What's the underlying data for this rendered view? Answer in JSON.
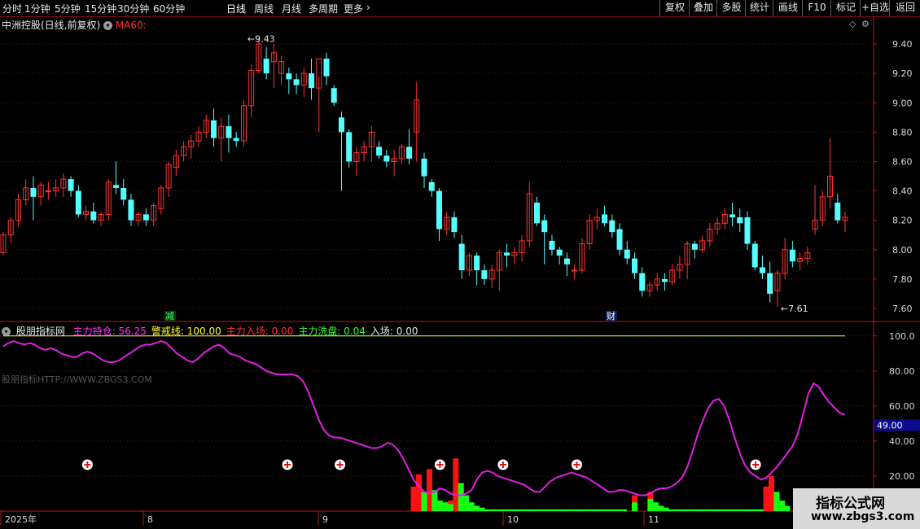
{
  "toolbar": {
    "periods": [
      "分时",
      "1分钟",
      "5分钟",
      "15分钟",
      "30分钟",
      "60分钟",
      "日线",
      "周线",
      "月线",
      "多周期",
      "更多"
    ],
    "active_period": "日线",
    "right_buttons": [
      "复权",
      "叠加",
      "多股",
      "统计",
      "画线",
      "F10",
      "标记",
      "+自选",
      "返回"
    ]
  },
  "header": {
    "stock_name": "中洲控股(日线,前复权)",
    "ma_label": "MA60:"
  },
  "chart_labels": {
    "high_label": "9.43",
    "low_label": "7.61",
    "badge_jian": "减",
    "badge_cai": "财"
  },
  "indicator": {
    "name": "股朋指标网",
    "items": [
      {
        "label": "主力持仓:",
        "value": "56.25",
        "color": "#ff33ff"
      },
      {
        "label": "警戒线:",
        "value": "100.00",
        "color": "#ffff33"
      },
      {
        "label": "主力入场:",
        "value": "0.00",
        "color": "#ff3333"
      },
      {
        "label": "主力洗盘:",
        "value": "0.04",
        "color": "#33ff33"
      },
      {
        "label": "入场:",
        "value": "0.00",
        "color": "#e8e8e8"
      }
    ],
    "watermark": "股朋指标HTTP://WWW.ZBGS3.COM",
    "current_value_tag": "49.00"
  },
  "price_axis": [
    "9.40",
    "9.20",
    "9.00",
    "8.80",
    "8.60",
    "8.40",
    "8.20",
    "8.00",
    "7.80",
    "7.60"
  ],
  "indicator_axis": [
    "100.0",
    "80.00",
    "60.00",
    "40.00",
    "20.00"
  ],
  "x_axis_labels": [
    "2025年",
    "8",
    "9",
    "10",
    "11"
  ],
  "logo": {
    "line1": "指标公式网",
    "line2": "www.zbgs3.com"
  },
  "colors": {
    "up": "#ff3333",
    "down": "#54ffff",
    "grid": "#5a1414",
    "axis": "#b01c1c",
    "line": "#e020e0"
  },
  "chart_data": [
    {
      "type": "candlestick",
      "title": "中洲控股(日线,前复权)",
      "ylim": [
        7.55,
        9.5
      ],
      "candles_ohlc": [
        [
          7.98,
          8.12,
          7.96,
          8.1
        ],
        [
          8.1,
          8.22,
          8.04,
          8.2
        ],
        [
          8.2,
          8.38,
          8.16,
          8.34
        ],
        [
          8.34,
          8.48,
          8.3,
          8.42
        ],
        [
          8.42,
          8.5,
          8.2,
          8.36
        ],
        [
          8.36,
          8.46,
          8.3,
          8.44
        ],
        [
          8.4,
          8.46,
          8.34,
          8.4
        ],
        [
          8.4,
          8.48,
          8.36,
          8.42
        ],
        [
          8.42,
          8.52,
          8.36,
          8.48
        ],
        [
          8.48,
          8.5,
          8.36,
          8.4
        ],
        [
          8.4,
          8.44,
          8.22,
          8.24
        ],
        [
          8.24,
          8.3,
          8.2,
          8.26
        ],
        [
          8.26,
          8.32,
          8.18,
          8.2
        ],
        [
          8.2,
          8.26,
          8.16,
          8.24
        ],
        [
          8.24,
          8.48,
          8.2,
          8.46
        ],
        [
          8.44,
          8.6,
          8.38,
          8.42
        ],
        [
          8.42,
          8.48,
          8.3,
          8.34
        ],
        [
          8.34,
          8.38,
          8.16,
          8.2
        ],
        [
          8.2,
          8.26,
          8.16,
          8.24
        ],
        [
          8.24,
          8.28,
          8.16,
          8.2
        ],
        [
          8.2,
          8.32,
          8.16,
          8.3
        ],
        [
          8.28,
          8.44,
          8.24,
          8.42
        ],
        [
          8.42,
          8.6,
          8.36,
          8.58
        ],
        [
          8.56,
          8.68,
          8.5,
          8.64
        ],
        [
          8.64,
          8.74,
          8.6,
          8.7
        ],
        [
          8.7,
          8.78,
          8.62,
          8.74
        ],
        [
          8.74,
          8.84,
          8.7,
          8.8
        ],
        [
          8.8,
          8.92,
          8.76,
          8.88
        ],
        [
          8.88,
          8.96,
          8.7,
          8.76
        ],
        [
          8.76,
          8.9,
          8.6,
          8.84
        ],
        [
          8.84,
          8.92,
          8.66,
          8.76
        ],
        [
          8.76,
          8.8,
          8.7,
          8.74
        ],
        [
          8.74,
          9.02,
          8.7,
          8.98
        ],
        [
          8.98,
          9.26,
          8.9,
          9.22
        ],
        [
          9.22,
          9.43,
          9.2,
          9.4
        ],
        [
          9.3,
          9.38,
          9.16,
          9.2
        ],
        [
          9.28,
          9.4,
          9.1,
          9.34
        ],
        [
          9.2,
          9.32,
          9.12,
          9.28
        ],
        [
          9.2,
          9.24,
          9.06,
          9.16
        ],
        [
          9.16,
          9.2,
          9.06,
          9.12
        ],
        [
          9.12,
          9.24,
          9.04,
          9.2
        ],
        [
          9.2,
          9.3,
          9.02,
          9.1
        ],
        [
          9.1,
          9.18,
          8.8,
          9.3
        ],
        [
          9.3,
          9.34,
          9.12,
          9.18
        ],
        [
          9.1,
          9.12,
          8.98,
          9.0
        ],
        [
          8.9,
          8.94,
          8.4,
          8.8
        ],
        [
          8.8,
          8.82,
          8.56,
          8.6
        ],
        [
          8.6,
          8.7,
          8.5,
          8.66
        ],
        [
          8.66,
          8.74,
          8.6,
          8.7
        ],
        [
          8.7,
          8.84,
          8.6,
          8.8
        ],
        [
          8.7,
          8.74,
          8.62,
          8.64
        ],
        [
          8.64,
          8.68,
          8.56,
          8.6
        ],
        [
          8.6,
          8.68,
          8.5,
          8.62
        ],
        [
          8.62,
          8.72,
          8.58,
          8.7
        ],
        [
          8.7,
          8.82,
          8.58,
          8.62
        ],
        [
          8.8,
          9.14,
          8.6,
          9.02
        ],
        [
          8.62,
          8.66,
          8.42,
          8.5
        ],
        [
          8.46,
          8.48,
          8.36,
          8.4
        ],
        [
          8.4,
          8.42,
          8.06,
          8.14
        ],
        [
          8.14,
          8.26,
          8.1,
          8.22
        ],
        [
          8.22,
          8.26,
          8.08,
          8.12
        ],
        [
          8.04,
          8.1,
          7.8,
          7.86
        ],
        [
          7.86,
          7.98,
          7.82,
          7.96
        ],
        [
          7.96,
          7.98,
          7.76,
          7.86
        ],
        [
          7.86,
          7.9,
          7.76,
          7.8
        ],
        [
          7.8,
          7.9,
          7.74,
          7.86
        ],
        [
          7.86,
          8.0,
          7.72,
          7.98
        ],
        [
          7.98,
          8.04,
          7.88,
          7.96
        ],
        [
          7.96,
          8.02,
          7.9,
          7.98
        ],
        [
          7.98,
          8.1,
          7.92,
          8.06
        ],
        [
          8.06,
          8.46,
          8.02,
          8.38
        ],
        [
          8.32,
          8.36,
          8.16,
          8.18
        ],
        [
          8.2,
          8.24,
          7.9,
          8.12
        ],
        [
          8.06,
          8.1,
          7.96,
          8.0
        ],
        [
          8.0,
          8.02,
          7.9,
          7.96
        ],
        [
          7.94,
          7.98,
          7.82,
          7.9
        ],
        [
          7.86,
          7.9,
          7.8,
          7.86
        ],
        [
          7.86,
          8.08,
          7.84,
          8.04
        ],
        [
          8.04,
          8.24,
          8.0,
          8.2
        ],
        [
          8.2,
          8.28,
          8.14,
          8.22
        ],
        [
          8.24,
          8.3,
          8.16,
          8.18
        ],
        [
          8.2,
          8.24,
          8.08,
          8.12
        ],
        [
          8.14,
          8.18,
          7.96,
          8.0
        ],
        [
          8.0,
          8.06,
          7.9,
          7.94
        ],
        [
          7.94,
          7.98,
          7.8,
          7.84
        ],
        [
          7.84,
          7.88,
          7.68,
          7.72
        ],
        [
          7.72,
          7.78,
          7.68,
          7.76
        ],
        [
          7.76,
          7.84,
          7.72,
          7.8
        ],
        [
          7.8,
          7.84,
          7.72,
          7.78
        ],
        [
          7.78,
          7.9,
          7.76,
          7.86
        ],
        [
          7.86,
          7.96,
          7.8,
          7.9
        ],
        [
          7.9,
          8.06,
          7.8,
          8.04
        ],
        [
          8.04,
          8.06,
          7.94,
          8.0
        ],
        [
          8.0,
          8.1,
          7.98,
          8.06
        ],
        [
          8.06,
          8.18,
          8.02,
          8.14
        ],
        [
          8.14,
          8.22,
          8.1,
          8.18
        ],
        [
          8.18,
          8.28,
          8.14,
          8.24
        ],
        [
          8.24,
          8.32,
          8.16,
          8.22
        ],
        [
          8.22,
          8.28,
          8.12,
          8.18
        ],
        [
          8.22,
          8.26,
          8.0,
          8.04
        ],
        [
          8.04,
          8.06,
          7.86,
          7.88
        ],
        [
          7.88,
          7.96,
          7.8,
          7.84
        ],
        [
          7.84,
          7.92,
          7.64,
          7.7
        ],
        [
          7.72,
          7.86,
          7.61,
          7.84
        ],
        [
          7.84,
          8.08,
          7.8,
          8.0
        ],
        [
          8.0,
          8.06,
          7.88,
          7.92
        ],
        [
          7.92,
          7.98,
          7.86,
          7.94
        ],
        [
          7.94,
          8.02,
          7.9,
          7.98
        ],
        [
          8.14,
          8.44,
          8.1,
          8.2
        ],
        [
          8.2,
          8.4,
          8.16,
          8.36
        ],
        [
          8.36,
          8.76,
          8.28,
          8.5
        ],
        [
          8.32,
          8.38,
          8.18,
          8.2
        ],
        [
          8.2,
          8.26,
          8.12,
          8.22
        ]
      ]
    },
    {
      "type": "line",
      "title": "股朋指标网",
      "ylim": [
        0,
        105
      ],
      "series": [
        {
          "name": "主力持仓",
          "values": [
            94,
            96,
            97,
            96,
            95,
            96,
            95,
            93,
            92,
            93,
            92,
            90,
            89,
            88,
            88,
            90,
            91,
            90,
            88,
            86,
            85,
            85,
            86,
            88,
            90,
            92,
            94,
            95,
            95,
            96,
            97,
            96,
            93,
            90,
            88,
            86,
            85,
            87,
            90,
            92,
            94,
            95,
            93,
            90,
            89,
            88,
            86,
            85,
            84,
            82,
            80,
            79,
            78,
            78,
            78,
            78,
            77,
            74,
            68,
            60,
            52,
            46,
            43,
            42,
            42,
            41,
            40,
            39,
            38,
            37,
            36,
            36,
            37,
            39,
            38,
            35,
            30,
            24,
            18,
            14,
            11,
            10,
            11,
            13,
            12,
            10,
            9,
            9,
            10,
            12,
            18,
            22,
            23,
            22,
            20,
            19,
            18,
            17,
            16,
            15,
            13,
            11,
            11,
            14,
            17,
            19,
            20,
            21,
            22,
            21,
            20,
            19,
            17,
            15,
            13,
            11,
            11,
            12,
            12,
            11,
            10,
            9,
            9,
            10,
            12,
            13,
            13,
            14,
            16,
            19,
            25,
            34,
            44,
            52,
            59,
            63,
            64,
            60,
            52,
            42,
            33,
            26,
            22,
            20,
            18,
            19,
            22,
            25,
            29,
            33,
            37,
            44,
            55,
            67,
            73,
            71,
            66,
            62,
            59,
            56,
            55
          ]
        },
        {
          "name": "警戒线",
          "values": [
            100
          ]
        }
      ],
      "bars_red": [
        0,
        0,
        0,
        0,
        0,
        0,
        0,
        0,
        0,
        0,
        0,
        0,
        0,
        0,
        0,
        0,
        0,
        0,
        0,
        0,
        0,
        0,
        0,
        0,
        0,
        0,
        0,
        0,
        0,
        0,
        0,
        0,
        0,
        0,
        0,
        0,
        0,
        0,
        0,
        0,
        0,
        0,
        0,
        0,
        0,
        0,
        0,
        0,
        0,
        0,
        0,
        0,
        0,
        0,
        0,
        0,
        0,
        0,
        0,
        0,
        0,
        0,
        0,
        0,
        0,
        0,
        0,
        0,
        0,
        0,
        0,
        0,
        0,
        0,
        0,
        0,
        0,
        0,
        14,
        21,
        0,
        24,
        0,
        0,
        0,
        6,
        30,
        0,
        0,
        0,
        0,
        0,
        0,
        0,
        0,
        0,
        0,
        0,
        0,
        0,
        0,
        0,
        0,
        0,
        0,
        0,
        0,
        0,
        0,
        0,
        0,
        0,
        0,
        0,
        0,
        0,
        0,
        0,
        0,
        0,
        9,
        0,
        0,
        11,
        0,
        0,
        0,
        0,
        0,
        0,
        0,
        0,
        0,
        0,
        0,
        0,
        0,
        0,
        0,
        0,
        0,
        0,
        0,
        0,
        0,
        14,
        20,
        0,
        0,
        0,
        0,
        0,
        0,
        0,
        0,
        0,
        0,
        0,
        0,
        0,
        0
      ],
      "bars_green": [
        0,
        0,
        0,
        0,
        0,
        0,
        0,
        0,
        0,
        0,
        0,
        0,
        0,
        0,
        0,
        0,
        0,
        0,
        0,
        0,
        0,
        0,
        0,
        0,
        0,
        0,
        0,
        0,
        0,
        0,
        0,
        0,
        0,
        0,
        0,
        0,
        0,
        0,
        0,
        0,
        0,
        0,
        0,
        0,
        0,
        0,
        0,
        0,
        0,
        0,
        0,
        0,
        0,
        0,
        0,
        0,
        0,
        0,
        0,
        0,
        0,
        0,
        0,
        0,
        0,
        0,
        0,
        0,
        0,
        0,
        0,
        0,
        0,
        0,
        0,
        0,
        0,
        0,
        0,
        0,
        11,
        0,
        12,
        6,
        5,
        4,
        0,
        16,
        9,
        5,
        3,
        2,
        1,
        1,
        1,
        1,
        1,
        1,
        1,
        1,
        1,
        1,
        1,
        1,
        1,
        1,
        1,
        1,
        1,
        1,
        1,
        1,
        1,
        1,
        1,
        1,
        1,
        1,
        1,
        0,
        5,
        0,
        0,
        7,
        5,
        3,
        2,
        1,
        1,
        1,
        1,
        1,
        1,
        1,
        1,
        1,
        1,
        1,
        1,
        1,
        1,
        1,
        1,
        1,
        1,
        0,
        0,
        11,
        6,
        3,
        0,
        0,
        0,
        0,
        0,
        0,
        0,
        0,
        0,
        0,
        0,
        0
      ],
      "entry_markers_at": [
        16,
        54,
        64,
        83,
        95,
        109,
        143
      ]
    }
  ]
}
